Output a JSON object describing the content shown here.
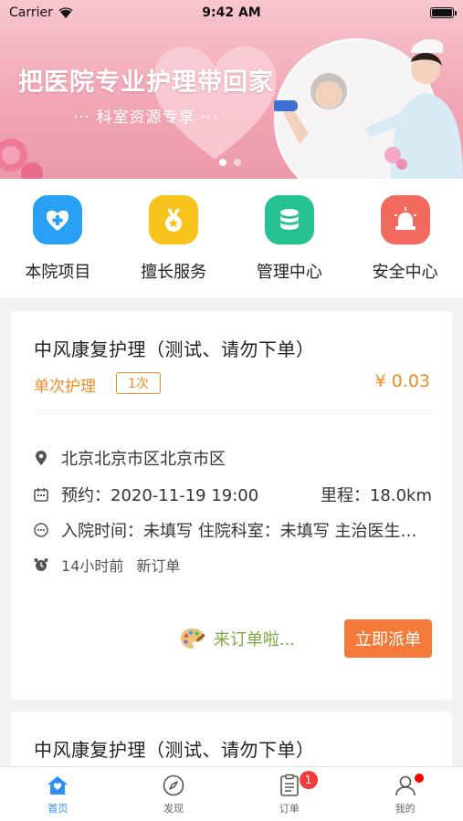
{
  "status_bar": {
    "carrier": "Carrier",
    "time": "9:42 AM"
  },
  "banner": {
    "title": "把医院专业护理带回家",
    "subtitle": "··· 科室资源专享 ···",
    "page_count": 2,
    "active_page": 1
  },
  "quick_menu": [
    {
      "label": "本院项目",
      "icon": "heart-plus-icon",
      "color": "#2aa0f5"
    },
    {
      "label": "擅长服务",
      "icon": "medal-icon",
      "color": "#f7c21c"
    },
    {
      "label": "管理中心",
      "icon": "database-icon",
      "color": "#27c291"
    },
    {
      "label": "安全中心",
      "icon": "alarm-light-icon",
      "color": "#f26a5e"
    }
  ],
  "orders": [
    {
      "title": "中风康复护理（测试、请勿下单）",
      "type": "单次护理",
      "count": "1次",
      "price": "¥ 0.03",
      "address": "北京北京市区北京市区",
      "appointment": "预约：2020-11-19 19:00",
      "mileage": "里程：18.0km",
      "admission": "入院时间：未填写 住院科室：未填写 主治医生：未填写",
      "time_ago": "14小时前",
      "status": "新订单",
      "notice": "来订单啦...",
      "action": "立即派单"
    },
    {
      "title": "中风康复护理（测试、请勿下单）"
    }
  ],
  "tab_bar": [
    {
      "label": "首页",
      "icon": "home-icon",
      "active": true
    },
    {
      "label": "发现",
      "icon": "compass-icon",
      "active": false
    },
    {
      "label": "订单",
      "icon": "order-list-icon",
      "active": false,
      "badge": "1"
    },
    {
      "label": "我的",
      "icon": "user-icon",
      "active": false,
      "dot": true
    }
  ],
  "colors": {
    "accent": "#f08a24",
    "primary": "#2c8ef8",
    "button": "#f47a3a",
    "notice": "#7ba83c"
  }
}
